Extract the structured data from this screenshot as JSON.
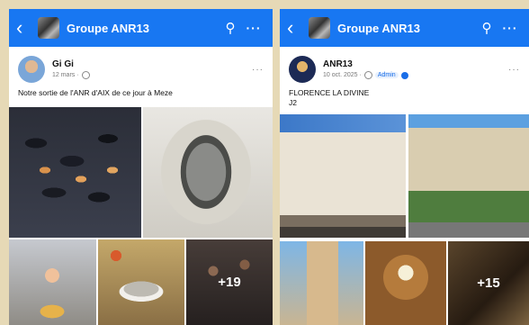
{
  "phones": [
    {
      "group_name": "Groupe ANR13",
      "author": "Gi Gi",
      "date": "12 mars ·",
      "text": "Notre sortie de l'ANR d'AIX de ce jour à Meze",
      "more_count": "+19",
      "icons": [
        "back-arrow-icon",
        "search-icon",
        "more-icon",
        "globe-icon"
      ]
    },
    {
      "group_name": "Groupe ANR13",
      "author": "ANR13",
      "date": "10 oct. 2025 ·",
      "badge": "Admin",
      "text_line1": "FLORENCE LA DIVINE",
      "text_line2": "J2",
      "more_count": "+15",
      "icons": [
        "back-arrow-icon",
        "search-icon",
        "more-icon",
        "globe-icon",
        "admin-shield-icon"
      ]
    }
  ],
  "colors": {
    "background": "#e6d9b6",
    "topbar": "#1877f2"
  }
}
